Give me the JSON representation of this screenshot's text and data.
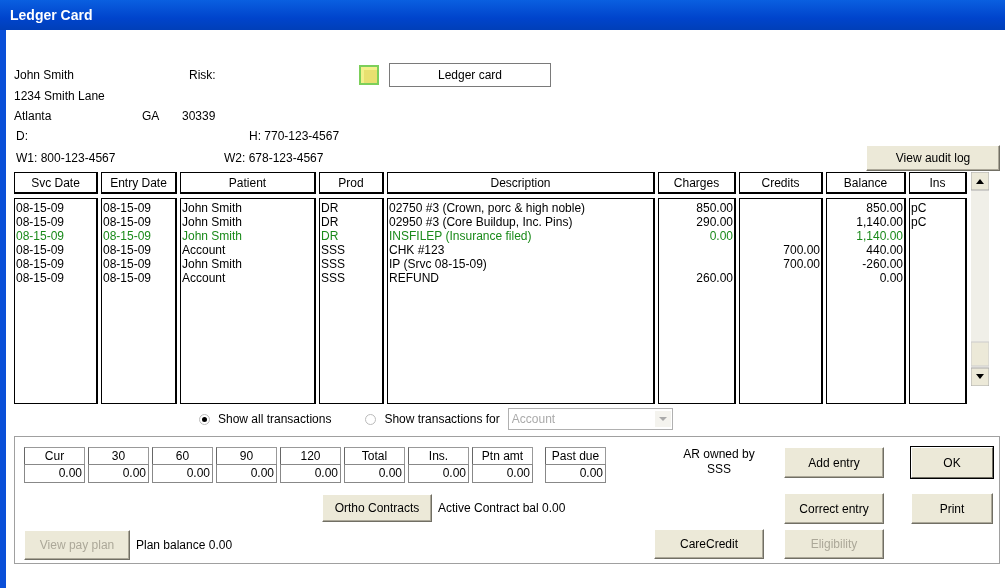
{
  "window": {
    "title": "Ledger Card"
  },
  "patient": {
    "name": "John Smith",
    "address": "1234 Smith Lane",
    "city": "Atlanta",
    "state": "GA",
    "zip": "30339",
    "d_label": "D:",
    "home_phone": "H: 770-123-4567",
    "work1": "W1: 800-123-4567",
    "work2": "W2: 678-123-4567",
    "risk_label": "Risk:"
  },
  "view_field": {
    "value": "Ledger card"
  },
  "audit_button": {
    "label": "View audit log",
    "disabled": false
  },
  "table": {
    "columns": [
      {
        "label": "Svc Date",
        "kind": "text"
      },
      {
        "label": "Entry Date",
        "kind": "text"
      },
      {
        "label": "Patient",
        "kind": "text"
      },
      {
        "label": "Prod",
        "kind": "text"
      },
      {
        "label": "Description",
        "kind": "text"
      },
      {
        "label": "Charges",
        "kind": "amount"
      },
      {
        "label": "Credits",
        "kind": "amount"
      },
      {
        "label": "Balance",
        "kind": "amount"
      },
      {
        "label": "Ins",
        "kind": "text"
      }
    ],
    "rows": [
      {
        "color": "#000000",
        "cells": [
          "08-15-09",
          "08-15-09",
          "John Smith",
          "DR",
          "02750 #3 (Crown, porc & high noble)",
          "850.00",
          null,
          "850.00",
          "pC"
        ]
      },
      {
        "color": "#000000",
        "cells": [
          "08-15-09",
          "08-15-09",
          "John Smith",
          "DR",
          "02950 #3 (Core Buildup, Inc. Pins)",
          "290.00",
          null,
          "1,140.00",
          "pC"
        ]
      },
      {
        "color": "#1a8a1a",
        "cells": [
          "08-15-09",
          "08-15-09",
          "John Smith",
          "DR",
          "INSFILEP (Insurance filed)",
          "0.00",
          null,
          "1,140.00",
          null
        ]
      },
      {
        "color": "#000000",
        "cells": [
          "08-15-09",
          "08-15-09",
          "Account",
          "SSS",
          "CHK #123",
          null,
          "700.00",
          "440.00",
          null
        ]
      },
      {
        "color": "#000000",
        "cells": [
          "08-15-09",
          "08-15-09",
          "John Smith",
          "SSS",
          "IP (Srvc 08-15-09)",
          null,
          "700.00",
          "-260.00",
          null
        ]
      },
      {
        "color": "#000000",
        "cells": [
          "08-15-09",
          "08-15-09",
          "Account",
          "SSS",
          "REFUND",
          "260.00",
          null,
          "0.00",
          null
        ]
      }
    ]
  },
  "filter": {
    "options": [
      {
        "label": "Show all transactions",
        "selected": true
      },
      {
        "label": "Show transactions for",
        "selected": false
      }
    ],
    "dropdown": {
      "value": "Account",
      "disabled": true
    }
  },
  "aging": [
    {
      "label": "Cur",
      "value": "0.00"
    },
    {
      "label": "30",
      "value": "0.00"
    },
    {
      "label": "60",
      "value": "0.00"
    },
    {
      "label": "90",
      "value": "0.00"
    },
    {
      "label": "120",
      "value": "0.00"
    },
    {
      "label": "Total",
      "value": "0.00"
    },
    {
      "label": "Ins.",
      "value": "0.00"
    },
    {
      "label": "Ptn amt",
      "value": "0.00"
    },
    {
      "label": "Past due",
      "value": "0.00"
    }
  ],
  "ar_owner": {
    "label": "AR owned by",
    "value": "SSS"
  },
  "ortho": {
    "button": {
      "label": "Ortho Contracts",
      "disabled": false
    },
    "text": "Active Contract bal  0.00"
  },
  "pay_plan": {
    "button": {
      "label": "View pay plan",
      "disabled": true
    },
    "text": "Plan balance  0.00"
  },
  "buttons": [
    {
      "label": "Add entry",
      "disabled": false,
      "default": false
    },
    {
      "label": "OK",
      "disabled": false,
      "default": true
    },
    {
      "label": "Correct entry",
      "disabled": false,
      "default": false
    },
    {
      "label": "Print",
      "disabled": false,
      "default": false
    },
    {
      "label": "CareCredit",
      "disabled": false,
      "default": false
    },
    {
      "label": "Eligibility",
      "disabled": true,
      "default": false
    }
  ]
}
